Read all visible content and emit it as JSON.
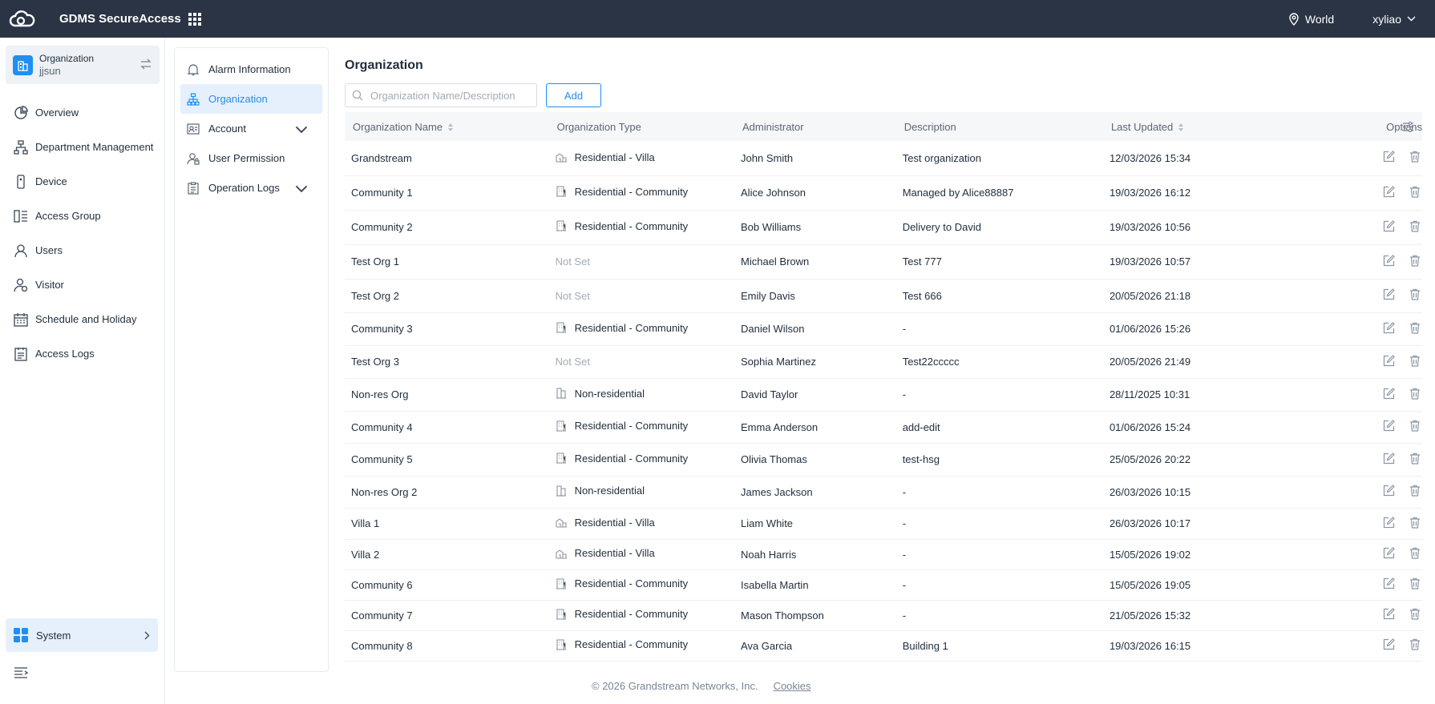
{
  "header": {
    "app_title": "GDMS SecureAccess",
    "location": "World",
    "username": "xyliao"
  },
  "sidebar": {
    "org_label": "Organization",
    "org_user": "jjsun",
    "items": [
      {
        "label": "Overview",
        "icon": "pie-chart-icon"
      },
      {
        "label": "Department Management",
        "icon": "org-tree-icon"
      },
      {
        "label": "Device",
        "icon": "device-icon"
      },
      {
        "label": "Access Group",
        "icon": "access-group-icon"
      },
      {
        "label": "Users",
        "icon": "user-icon"
      },
      {
        "label": "Visitor",
        "icon": "visitor-icon"
      },
      {
        "label": "Schedule and Holiday",
        "icon": "calendar-icon"
      },
      {
        "label": "Access Logs",
        "icon": "logs-icon"
      }
    ],
    "system_label": "System"
  },
  "submenu": {
    "items": [
      {
        "label": "Alarm Information",
        "icon": "bell-icon"
      },
      {
        "label": "Organization",
        "icon": "org-tree-icon",
        "active": true
      },
      {
        "label": "Account",
        "icon": "account-icon",
        "expandable": true
      },
      {
        "label": "User Permission",
        "icon": "user-permission-icon"
      },
      {
        "label": "Operation Logs",
        "icon": "clipboard-icon",
        "expandable": true
      }
    ]
  },
  "main": {
    "title": "Organization",
    "search_placeholder": "Organization Name/Description",
    "add_label": "Add",
    "columns": {
      "name": "Organization Name",
      "type": "Organization Type",
      "admin": "Administrator",
      "desc": "Description",
      "updated": "Last Updated",
      "options": "Options"
    },
    "rows": [
      {
        "name": "Grandstream",
        "type": "Residential - Villa",
        "type_icon": "villa-icon",
        "admin": "John Smith",
        "desc": "Test organization",
        "updated": "12/03/2026 15:34"
      },
      {
        "name": "Community 1",
        "type": "Residential - Community",
        "type_icon": "community-icon",
        "admin": "Alice Johnson",
        "desc": "Managed by Alice88887",
        "updated": "19/03/2026 16:12"
      },
      {
        "name": "Community 2",
        "type": "Residential - Community",
        "type_icon": "community-icon",
        "admin": "Bob Williams",
        "desc": "Delivery to David",
        "updated": "19/03/2026 10:56"
      },
      {
        "name": "Test Org 1",
        "type": "Not Set",
        "type_icon": "",
        "admin": "Michael Brown",
        "desc": "Test 777",
        "updated": "19/03/2026 10:57"
      },
      {
        "name": "Test Org 2",
        "type": "Not Set",
        "type_icon": "",
        "admin": "Emily Davis",
        "desc": "Test 666",
        "updated": "20/05/2026 21:18"
      },
      {
        "name": "Community 3",
        "type": "Residential - Community",
        "type_icon": "community-icon",
        "admin": "Daniel Wilson",
        "desc": "-",
        "updated": "01/06/2026 15:26"
      },
      {
        "name": "Test Org 3",
        "type": "Not Set",
        "type_icon": "",
        "admin": "Sophia Martinez",
        "desc": "Test22ccccc",
        "updated": "20/05/2026 21:49"
      },
      {
        "name": "Non-res Org",
        "type": "Non-residential",
        "type_icon": "building-icon",
        "admin": "David Taylor",
        "desc": "-",
        "updated": "28/11/2025 10:31"
      },
      {
        "name": "Community 4",
        "type": "Residential - Community",
        "type_icon": "community-icon",
        "admin": "Emma Anderson",
        "desc": "add-edit",
        "updated": "01/06/2026 15:24"
      },
      {
        "name": "Community 5",
        "type": "Residential - Community",
        "type_icon": "community-icon",
        "admin": "Olivia Thomas",
        "desc": "test-hsg",
        "updated": "25/05/2026 20:22"
      },
      {
        "name": "Non-res Org 2",
        "type": "Non-residential",
        "type_icon": "building-icon",
        "admin": "James Jackson",
        "desc": "-",
        "updated": "26/03/2026 10:15"
      },
      {
        "name": "Villa 1",
        "type": "Residential - Villa",
        "type_icon": "villa-icon",
        "admin": "Liam White",
        "desc": "-",
        "updated": "26/03/2026 10:17"
      },
      {
        "name": "Villa 2",
        "type": "Residential - Villa",
        "type_icon": "villa-icon",
        "admin": "Noah Harris",
        "desc": "-",
        "updated": "15/05/2026 19:02"
      },
      {
        "name": "Community 6",
        "type": "Residential - Community",
        "type_icon": "community-icon",
        "admin": "Isabella Martin",
        "desc": "-",
        "updated": "15/05/2026 19:05"
      },
      {
        "name": "Community 7",
        "type": "Residential - Community",
        "type_icon": "community-icon",
        "admin": "Mason Thompson",
        "desc": "-",
        "updated": "21/05/2026 15:32"
      },
      {
        "name": "Community 8",
        "type": "Residential - Community",
        "type_icon": "community-icon",
        "admin": "Ava Garcia",
        "desc": "Building 1",
        "updated": "19/03/2026 16:15"
      }
    ]
  },
  "footer": {
    "copyright": "© 2026 Grandstream Networks, Inc.",
    "cookies": "Cookies"
  },
  "colors": {
    "topbar": "#2b3445",
    "accent": "#1f8ff2",
    "active_bg": "#e6f0fc"
  }
}
